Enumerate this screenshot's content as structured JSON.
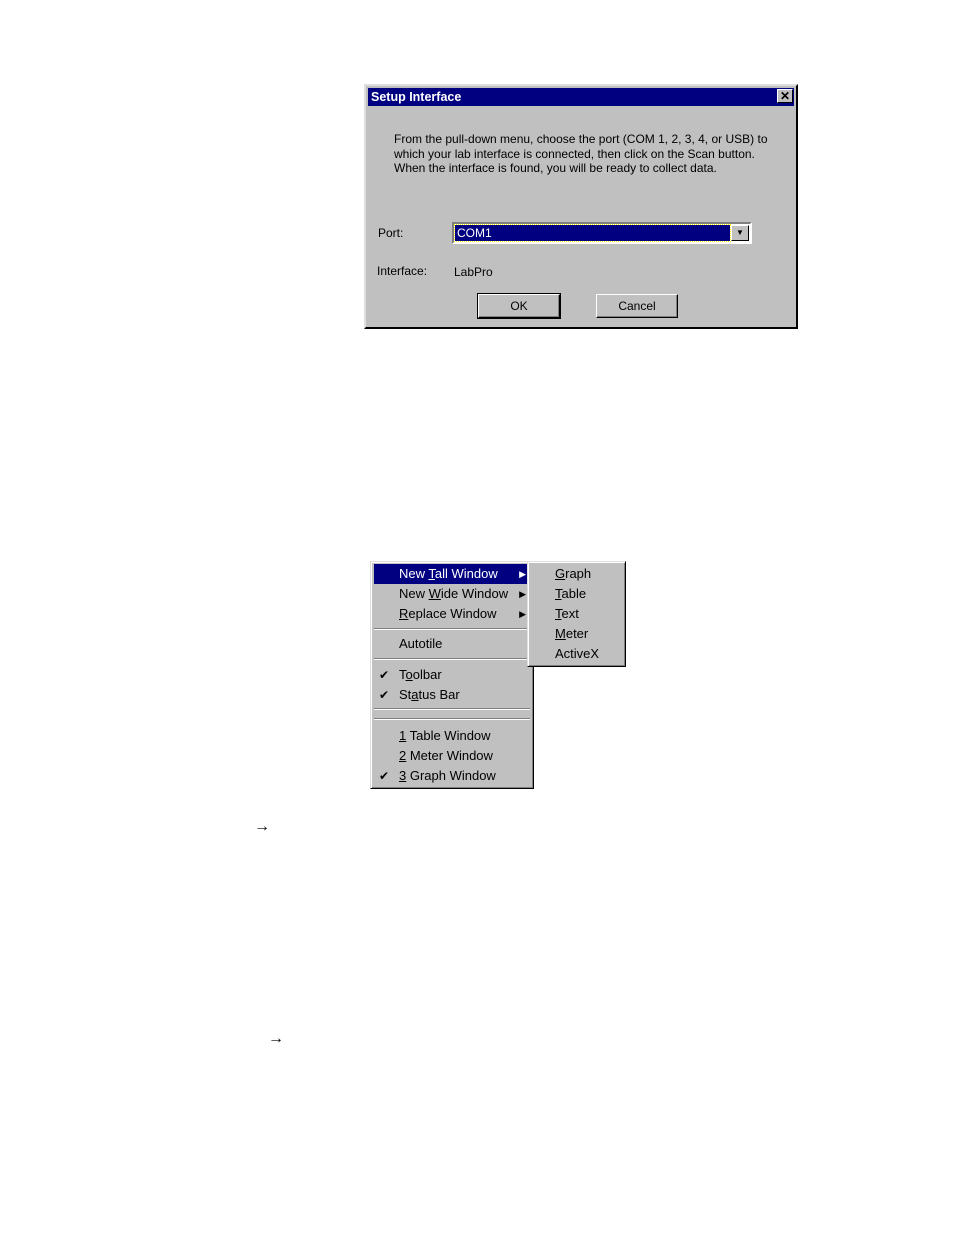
{
  "dialog": {
    "title": "Setup Interface",
    "close_icon": "close-icon",
    "message": "From the pull-down menu, choose the port (COM 1, 2, 3, 4, or USB) to which your lab interface is connected, then click on the Scan button. When the interface is found, you will be ready to collect data.",
    "port_label": "Port:",
    "port_value": "COM1",
    "interface_label": "Interface:",
    "interface_value": "LabPro",
    "ok": "OK",
    "cancel": "Cancel"
  },
  "menu": {
    "items": [
      {
        "pre": "New ",
        "key": "T",
        "post": "all Window",
        "submenu": true,
        "selected": true
      },
      {
        "pre": "New ",
        "key": "W",
        "post": "ide Window",
        "submenu": true
      },
      {
        "pre": "",
        "key": "R",
        "post": "eplace Window",
        "submenu": true
      },
      {
        "pre": "Autotile",
        "key": "",
        "post": ""
      },
      {
        "pre": "T",
        "key": "o",
        "post": "olbar",
        "checked": true
      },
      {
        "pre": "St",
        "key": "a",
        "post": "tus Bar",
        "checked": true
      },
      {
        "pre": "",
        "key": "1",
        "post": " Table  Window"
      },
      {
        "pre": "",
        "key": "2",
        "post": " Meter  Window"
      },
      {
        "pre": "",
        "key": "3",
        "post": " Graph Window",
        "checked": true
      }
    ],
    "submenu": [
      {
        "key": "G",
        "post": "raph"
      },
      {
        "key": "T",
        "post": "able"
      },
      {
        "key": "T",
        "post": "ext"
      },
      {
        "key": "M",
        "post": "eter"
      },
      {
        "key": "",
        "post": "ActiveX"
      }
    ]
  },
  "arrows": [
    "→",
    "→"
  ]
}
